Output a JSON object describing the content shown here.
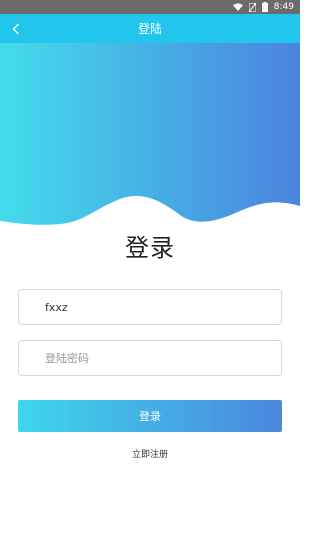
{
  "status_bar": {
    "time": "8:49",
    "icons": [
      "wifi-icon",
      "no-sim-icon",
      "battery-icon"
    ]
  },
  "navbar": {
    "back_icon": "chevron-left-icon",
    "title": "登陆"
  },
  "colors": {
    "navbar": "#22c6ec",
    "gradient_start": "#3fd6ec",
    "gradient_end": "#4a86de",
    "status_bar": "#6b6b6b"
  },
  "form": {
    "heading": "登录",
    "username_value": "fxxz",
    "password_placeholder": "登陆密码",
    "submit_label": "登录",
    "register_link": "立即注册"
  }
}
